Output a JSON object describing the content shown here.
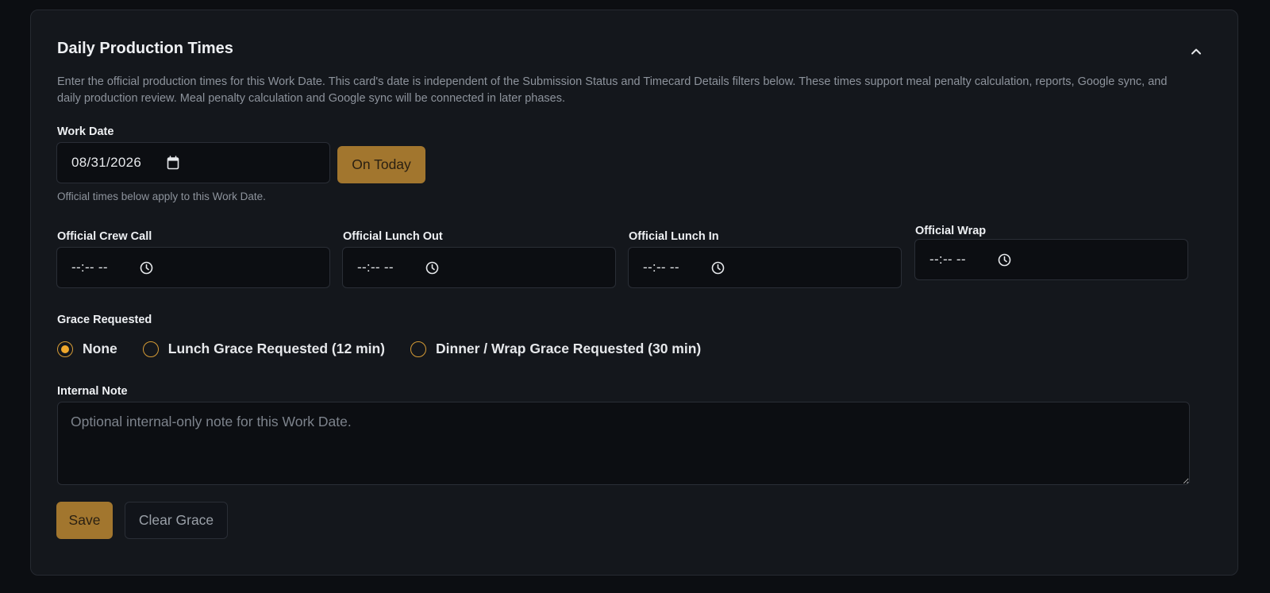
{
  "card": {
    "title": "Daily Production Times",
    "description": "Enter the official production times for this Work Date. This card's date is independent of the Submission Status and Timecard Details filters below. These times support meal penalty calculation, reports, Google sync, and daily production review. Meal penalty calculation and Google sync will be connected in later phases."
  },
  "work_date": {
    "label": "Work Date",
    "value": "08/31/2026",
    "on_today_label": "On Today",
    "helper": "Official times below apply to this Work Date."
  },
  "times": [
    {
      "label": "Official Crew Call",
      "value": "--:-- --"
    },
    {
      "label": "Official Lunch Out",
      "value": "--:-- --"
    },
    {
      "label": "Official Lunch In",
      "value": "--:-- --"
    },
    {
      "label": "Official Wrap",
      "value": "--:-- --"
    }
  ],
  "grace": {
    "label": "Grace Requested",
    "options": [
      {
        "label": "None",
        "checked": true
      },
      {
        "label": "Lunch Grace Requested (12 min)",
        "checked": false
      },
      {
        "label": "Dinner / Wrap Grace Requested (30 min)",
        "checked": false
      }
    ]
  },
  "note": {
    "label": "Internal Note",
    "placeholder": "Optional internal-only note for this Work Date."
  },
  "actions": {
    "save_label": "Save",
    "clear_label": "Clear Grace"
  },
  "colors": {
    "accent": "#f0a82c",
    "primary_button": "#a2762e",
    "card_bg": "#14171c",
    "page_bg": "#0c0e12"
  },
  "icons": {
    "collapse": "chevron-up-icon",
    "date": "calendar-icon",
    "time": "clock-icon"
  }
}
